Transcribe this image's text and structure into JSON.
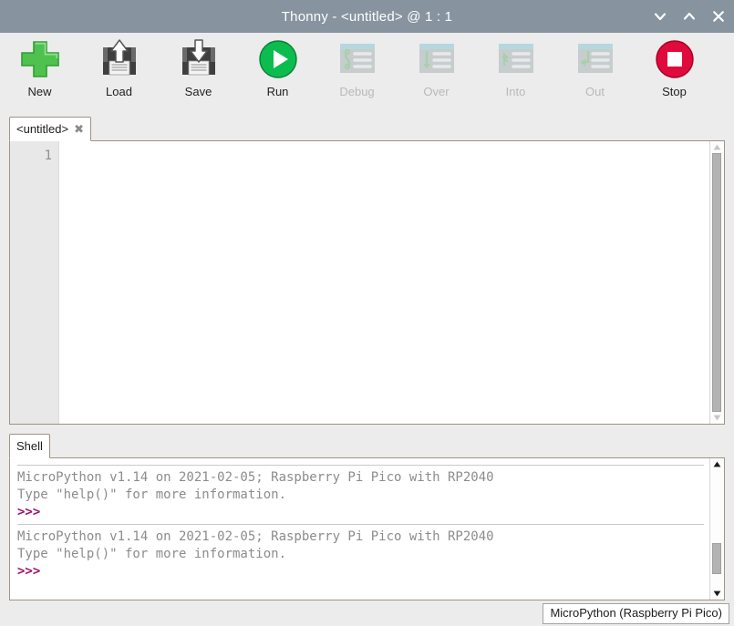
{
  "window": {
    "title": "Thonny  -  <untitled> @  1 : 1",
    "controls": [
      {
        "name": "minimize",
        "glyph": "chevron-down"
      },
      {
        "name": "maximize",
        "glyph": "chevron-up"
      },
      {
        "name": "close",
        "glyph": "x"
      }
    ],
    "titlebar_color": "#8794a0"
  },
  "toolbar": {
    "items": [
      {
        "label": "New",
        "icon": "plus-icon",
        "enabled": true
      },
      {
        "label": "Load",
        "icon": "floppy-up-arrow-icon",
        "enabled": true
      },
      {
        "label": "Save",
        "icon": "floppy-down-arrow-icon",
        "enabled": true
      },
      {
        "label": "Run",
        "icon": "play-circle-icon",
        "enabled": true
      },
      {
        "label": "Debug",
        "icon": "debug-window-icon",
        "enabled": false
      },
      {
        "label": "Over",
        "icon": "step-over-icon",
        "enabled": false
      },
      {
        "label": "Into",
        "icon": "step-into-icon",
        "enabled": false
      },
      {
        "label": "Out",
        "icon": "step-out-icon",
        "enabled": false
      },
      {
        "label": "Stop",
        "icon": "stop-circle-icon",
        "enabled": true
      }
    ],
    "accent_colors": {
      "new_green": "#4ec14e",
      "run_green": "#0bbd4f",
      "stop_red": "#e00a3c"
    }
  },
  "editor": {
    "tab_label": "<untitled>",
    "tab_close_glyph": "✖",
    "line_numbers": [
      "1"
    ],
    "content": "",
    "scrollbar": {
      "thumb_top_pct": 0,
      "thumb_height_pct": 100
    }
  },
  "shell": {
    "tab_label": "Shell",
    "blocks": [
      {
        "lines": [
          "MicroPython v1.14 on 2021-02-05; Raspberry Pi Pico with RP2040",
          "Type \"help()\" for more information."
        ],
        "prompt": ">>>"
      },
      {
        "lines": [
          "MicroPython v1.14 on 2021-02-05; Raspberry Pi Pico with RP2040",
          "Type \"help()\" for more information."
        ],
        "prompt": ">>>"
      }
    ],
    "scrollbar": {
      "thumb_top_pct": 62,
      "thumb_height_pct": 26
    }
  },
  "statusbar": {
    "interpreter": "MicroPython (Raspberry Pi Pico)"
  }
}
